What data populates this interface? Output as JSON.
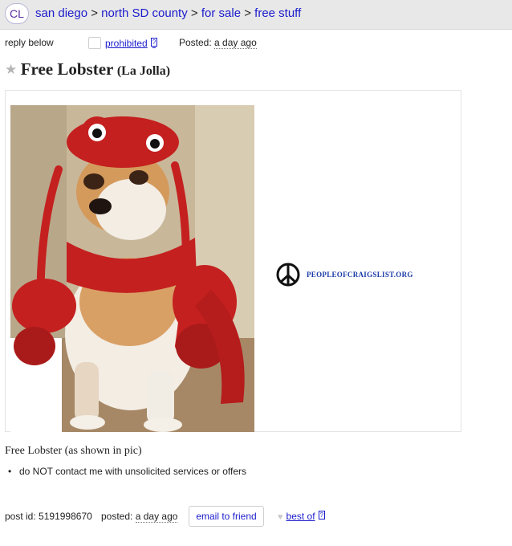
{
  "breadcrumb": {
    "logo": "CL",
    "items": [
      "san diego",
      "north SD county",
      "for sale",
      "free stuff"
    ],
    "separator": ">"
  },
  "postinfo": {
    "reply": "reply below",
    "prohibited": "prohibited",
    "help_mark": "?",
    "posted_label": "Posted:",
    "posted_time": "a day ago"
  },
  "posting": {
    "title": "Free Lobster",
    "location": "(La Jolla)",
    "watermark": "PEOPLEOFCRAIGSLIST.ORG",
    "body": "Free Lobster (as shown in pic)",
    "notice": "do NOT contact me with unsolicited services or offers"
  },
  "footer": {
    "post_id_label": "post id:",
    "post_id": "5191998670",
    "posted_label": "posted:",
    "posted_time": "a day ago",
    "email_label": "email to friend",
    "best_of_label": "best of",
    "help_mark": "?"
  },
  "colors": {
    "link": "#1c1ccc",
    "lobster_red": "#c4201f",
    "topbar": "#e8e8e8"
  }
}
